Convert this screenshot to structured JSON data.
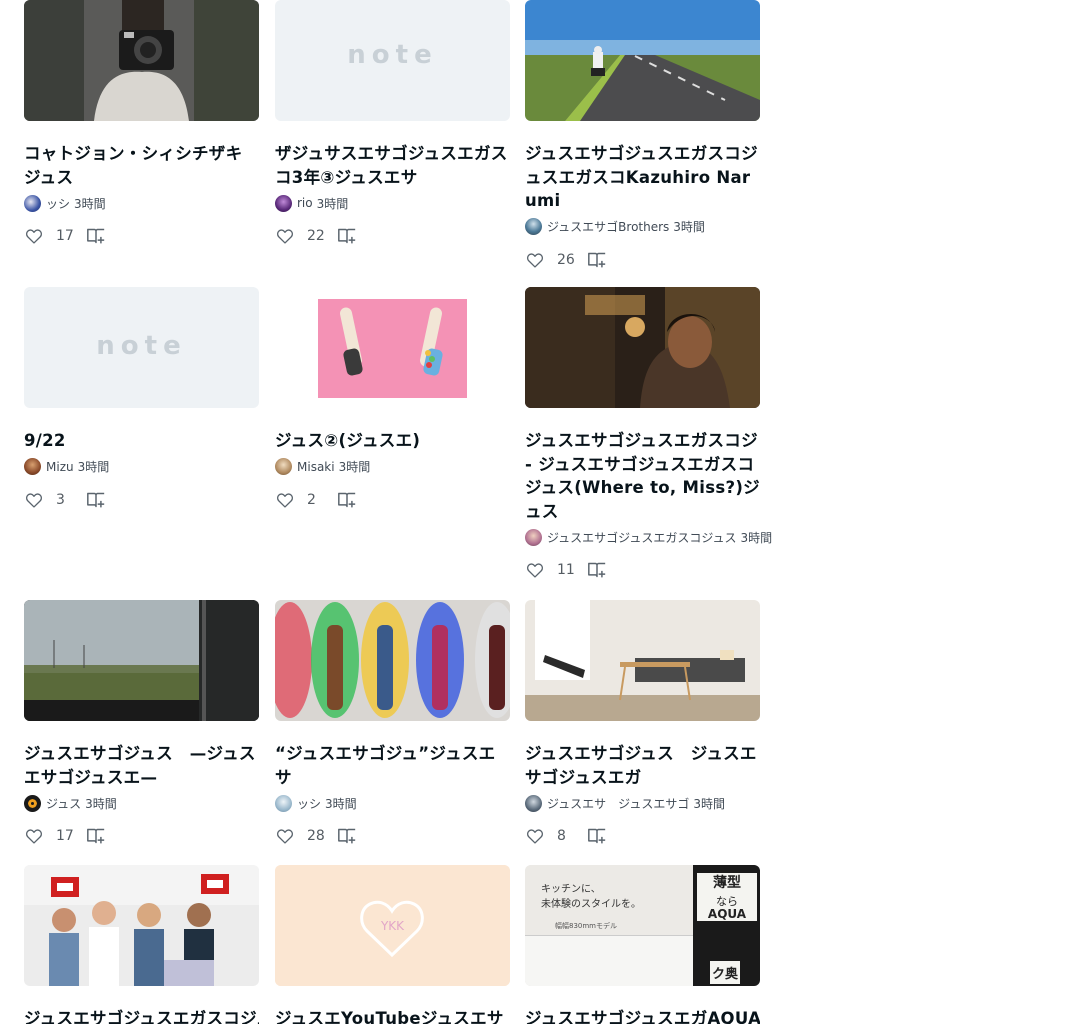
{
  "cards": [
    {
      "title": "コャトジョン・シィシチザキジュス",
      "author": "ッシ",
      "time": "3時間",
      "likes": "17"
    },
    {
      "title": "ザジュサスエサゴジュスエガスコ3年③ジュスエサ",
      "author": "rio",
      "time": "3時間",
      "likes": "22"
    },
    {
      "title": "ジュスエサゴジュスエガスコジュスエガスコKazuhiro Narumi",
      "author": "ジュスエサゴBrothers",
      "time": "3時間",
      "likes": "26"
    },
    {
      "title": "9/22",
      "author": "Mizu",
      "time": "3時間",
      "likes": "3"
    },
    {
      "title": "ジュス②(ジュスエ)",
      "author": "Misaki",
      "time": "3時間",
      "likes": "2"
    },
    {
      "title": "ジュスエサゴジュスエガスコジ - ジュスエサゴジュスエガスコジュス(Where to, Miss?)ジュス",
      "author": "ジュスエサゴジュスエガスコジュス",
      "time": "3時間",
      "likes": "11"
    },
    {
      "title": "ジュスエサゴジュス　—ジュスエサゴジュスエ—",
      "author": "ジュス",
      "time": "3時間",
      "likes": "17"
    },
    {
      "title": "“ジュスエサゴジュ”ジュスエサ",
      "author": "ッシ",
      "time": "3時間",
      "likes": "28"
    },
    {
      "title": "ジュスエサゴジュス　ジュスエサゴジュスエガ",
      "author": "ジュスエサ　ジュスエサゴ",
      "time": "3時間",
      "likes": "8"
    },
    {
      "title": "ジュスエサゴジュスエガスコジュスエガスコジュスエ",
      "author": "",
      "time": "",
      "likes": ""
    },
    {
      "title": "ジュスエYouTubeジュスエサ",
      "author": "",
      "time": "",
      "likes": ""
    },
    {
      "title": "ジュスエサゴジュスエガAQUAジュスエサ",
      "author": "",
      "time": "",
      "likes": ""
    }
  ],
  "thumbs": {
    "note_logo": "note",
    "ykk_heart_label": "YKK",
    "aqua_ad_line1": "キッチンに、",
    "aqua_ad_line2": "未体験のスタイルを。",
    "aqua_ad_small": "幅幅830mmモデル",
    "aqua_sign1": "薄型",
    "aqua_sign2": "なら",
    "aqua_sign3": "AQUA",
    "aqua_sign4": "ク奥"
  },
  "colors": {
    "text": "#08131a",
    "meta": "#404a55",
    "icon": "#5a646d",
    "placeholder_bg": "#eef2f5",
    "placeholder_logo": "#c8d0d6"
  }
}
